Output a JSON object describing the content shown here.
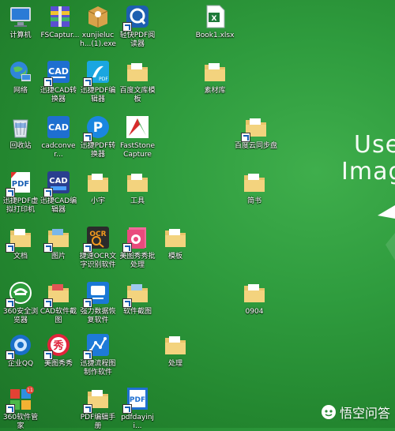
{
  "wallpaper": {
    "line1": "Use",
    "line2": "Imag"
  },
  "watermark": "悟空问答",
  "icons": {
    "computer": "计算机",
    "fscapture": "FSCaptur...",
    "xunjie_exe": "xunjieluch...(1).exe",
    "qingkuai_pdf": "轻快PDF阅读器",
    "book1": "Book1.xlsx",
    "network": "网络",
    "cad_converter": "迅捷CAD转换器",
    "pdf_editor": "迅捷PDF编辑器",
    "baidu_wenku": "百度文库模板",
    "sucaiku": "素材库",
    "recycle_bin": "回收站",
    "cadconver": "cadconver...",
    "pdf_converter": "迅捷PDF转换器",
    "faststone": "FastStone Capture",
    "baidu_pan": "百度云同步盘",
    "pdf_printer": "迅捷PDF虚拟打印机",
    "cad_editor": "迅捷CAD编辑器",
    "xiaoyu": "小宇",
    "gongju": "工具",
    "jianshu": "简书",
    "wendang": "文档",
    "tupian": "图片",
    "ocr": "捷速OCR文字识别软件",
    "meitu_batch": "美图秀秀批处理",
    "moban": "模板",
    "browser360": "360安全浏览器",
    "cad_screenshot": "CAD软件截图",
    "data_recovery": "强力数据恢复软件",
    "software_shot": "软件截图",
    "folder0904": "0904",
    "qq": "企业QQ",
    "meitu": "美图秀秀",
    "flowchart": "迅捷流程图制作软件",
    "chuli": "处理",
    "manager360": "360软件管家",
    "pdf_manual": "PDF编辑手册",
    "pdfdayin": "pdfdayinji..."
  }
}
